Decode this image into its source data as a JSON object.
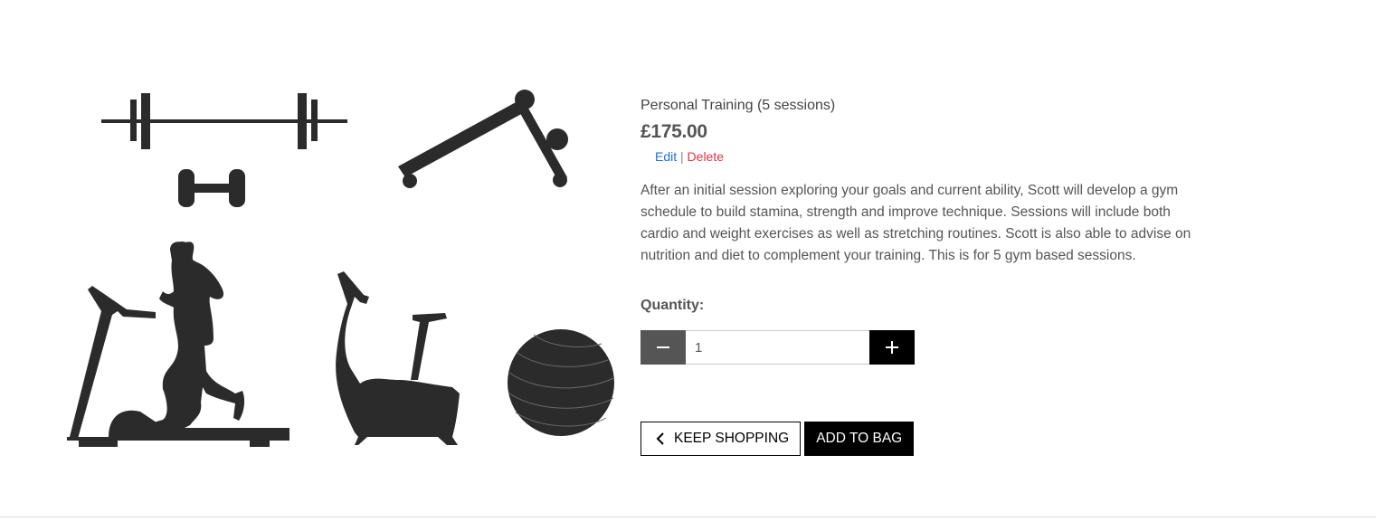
{
  "product": {
    "name": "Personal Training (5 sessions)",
    "price": "£175.00",
    "image_description_icon": "gym-equipment-illustration",
    "description": "After an initial session exploring your goals and current ability, Scott will develop a gym schedule to build stamina, strength and improve technique. Sessions will include both cardio and weight exercises as well as stretching routines. Scott is also able to advise on nutrition and diet to complement your training. This is for 5 gym based sessions."
  },
  "admin": {
    "edit_label": "Edit",
    "separator": "|",
    "delete_label": "Delete"
  },
  "quantity": {
    "label": "Quantity:",
    "value": "1",
    "minus_icon": "minus-icon",
    "plus_icon": "plus-icon"
  },
  "actions": {
    "keep_shopping_label": "KEEP SHOPPING",
    "add_to_bag_label": "ADD TO BAG",
    "chevron_icon": "chevron-left-icon"
  },
  "colors": {
    "edit_link": "#1e6fd9",
    "delete_link": "#dc3545",
    "minus_button": "#555555",
    "plus_button": "#000000",
    "add_to_bag_button": "#000000",
    "silhouette": "#2b2b2b"
  }
}
